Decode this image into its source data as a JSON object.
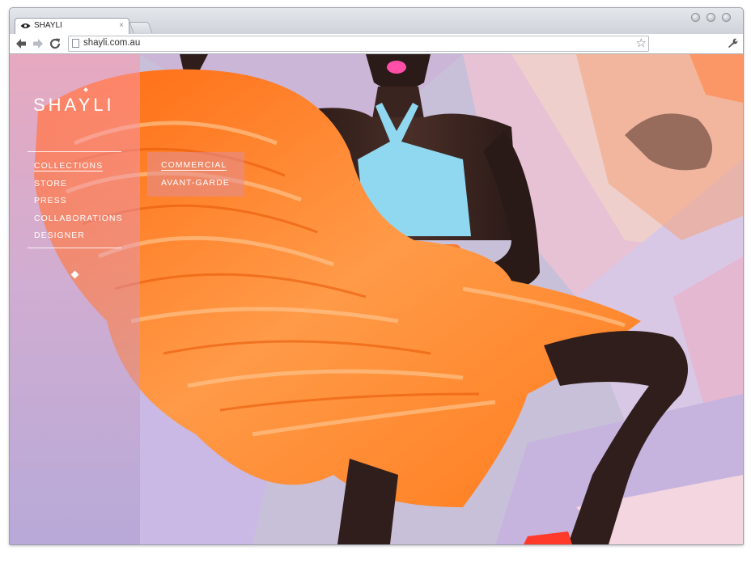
{
  "browser": {
    "tab_title": "SHAYLI",
    "tab_close": "×",
    "url": "shayli.com.au",
    "star_glyph": "☆"
  },
  "site": {
    "logo": "SHAYLI",
    "menu": [
      {
        "label": "COLLECTIONS",
        "active": true
      },
      {
        "label": "STORE",
        "active": false
      },
      {
        "label": "PRESS",
        "active": false
      },
      {
        "label": "COLLABORATIONS",
        "active": false
      },
      {
        "label": "DESIGNER",
        "active": false
      }
    ],
    "submenu": [
      "COMMERCIAL",
      "AVANT-GARDE"
    ]
  },
  "colors": {
    "dress_orange": "#ff7a1a",
    "top_blue": "#8fd8ef",
    "panel_pink": "#ff96aa"
  },
  "icons": [
    "eye-icon",
    "back-icon",
    "forward-icon",
    "reload-icon",
    "page-icon",
    "star-icon",
    "wrench-icon",
    "diamond-icon"
  ]
}
